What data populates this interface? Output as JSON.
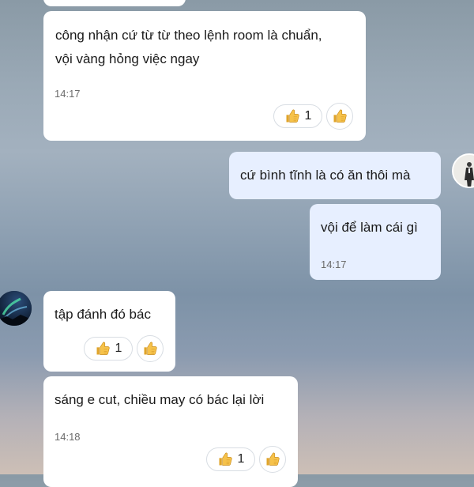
{
  "chat": {
    "messages": [
      {
        "id": "m0",
        "direction": "received",
        "text": ""
      },
      {
        "id": "m1",
        "direction": "received",
        "lines": [
          "công nhận cứ từ từ theo lệnh room là chuẩn,",
          "vội vàng hỏng việc ngay"
        ],
        "time": "14:17",
        "reaction": {
          "icon": "thumbs-up-icon",
          "count": "1"
        }
      },
      {
        "id": "m2",
        "direction": "sent",
        "text": "cứ bình tĩnh là có ăn thôi mà"
      },
      {
        "id": "m3",
        "direction": "sent",
        "text": "vội để làm cái gì",
        "time": "14:17"
      },
      {
        "id": "m4",
        "direction": "received",
        "text": "tập đánh đó bác",
        "reaction": {
          "icon": "thumbs-up-icon",
          "count": "1"
        }
      },
      {
        "id": "m5",
        "direction": "received",
        "text": "sáng e cut, chiều may có bác lại lời",
        "time": "14:18",
        "reaction": {
          "icon": "thumbs-up-icon",
          "count": "1"
        }
      }
    ]
  },
  "colors": {
    "received_bubble": "#ffffff",
    "sent_bubble": "#e7efff",
    "thumb_fill": "#f6c24a"
  }
}
